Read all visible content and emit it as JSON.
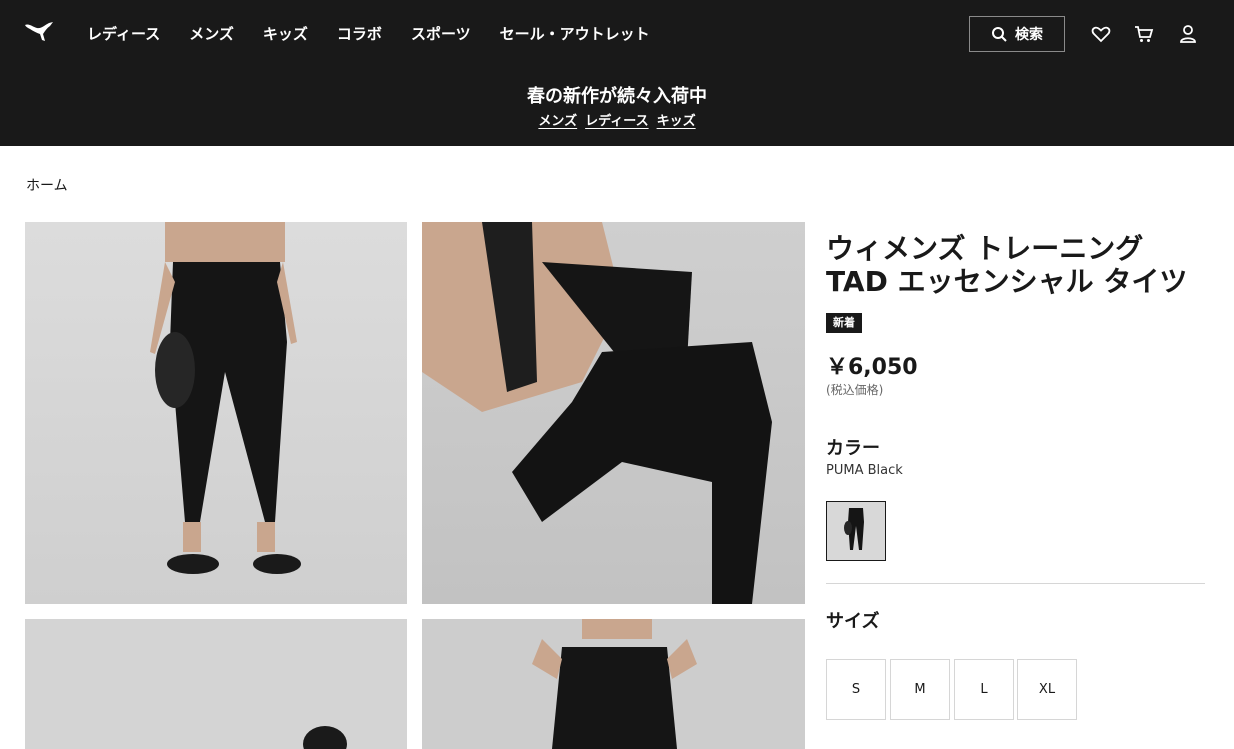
{
  "header": {
    "logo": "puma-logo",
    "nav": [
      "レディース",
      "メンズ",
      "キッズ",
      "コラボ",
      "スポーツ",
      "セール・アウトレット"
    ],
    "search_label": "検索",
    "icons": [
      "search-icon",
      "heart-icon",
      "cart-icon",
      "user-icon"
    ]
  },
  "promo": {
    "title": "春の新作が続々入荷中",
    "links": [
      "メンズ",
      "レディース",
      "キッズ"
    ]
  },
  "breadcrumb": "ホーム",
  "product": {
    "title_line1": "ウィメンズ トレーニング",
    "title_line2": "TAD エッセンシャル タイツ",
    "badge": "新着",
    "price": "￥6,050",
    "tax_note": "(税込価格)",
    "color_heading": "カラー",
    "color_name": "PUMA Black",
    "size_heading": "サイズ",
    "sizes": [
      "S",
      "M",
      "L",
      "XL"
    ]
  },
  "colors": {
    "header_bg": "#191919",
    "text": "#191919",
    "muted": "#676767",
    "border": "#d6d6d6"
  }
}
